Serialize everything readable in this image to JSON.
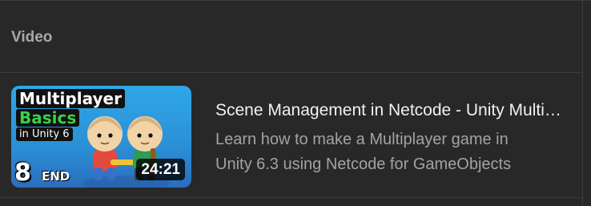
{
  "header": {
    "label": "Video"
  },
  "video": {
    "title": "Scene Management in Netcode - Unity Multiplayer Basics",
    "description_lines": [
      "Learn how to make a Multiplayer game in",
      "Unity 6.3 using Netcode for GameObjects"
    ],
    "duration": "24:21",
    "thumbnail": {
      "line1": "Multiplayer",
      "line2": "Basics",
      "line3": "in Unity 6",
      "episode_number": "8",
      "episode_tag": "END"
    }
  },
  "colors": {
    "background": "#282828",
    "divider": "#3c3c3c",
    "title_text": "#f1f1f1",
    "secondary_text": "#a3a3a3",
    "thumb_accent_green": "#38d14a"
  }
}
